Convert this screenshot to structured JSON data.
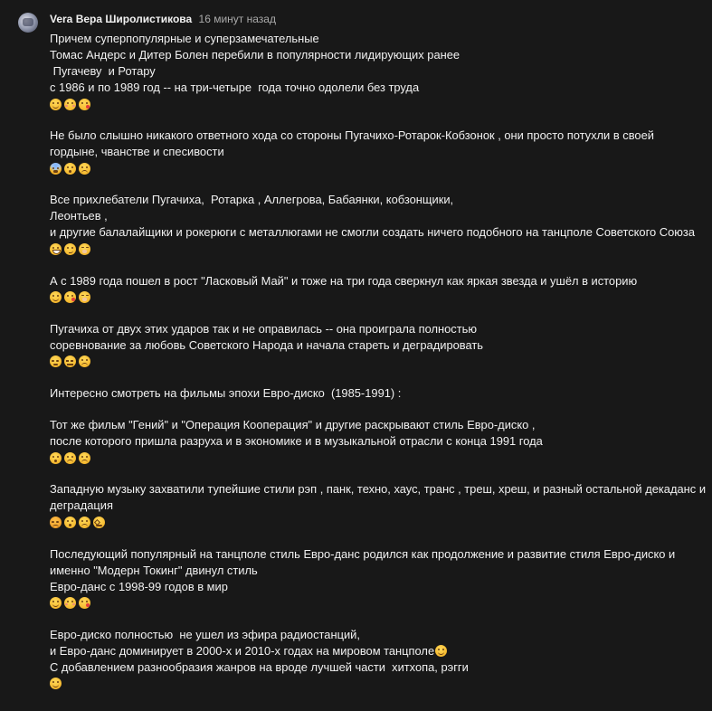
{
  "comment": {
    "author": "Vera Вера Широлистикова",
    "time": "16 минут назад",
    "paragraphs": [
      {
        "lines": [
          "Причем суперпопулярные и суперзамечательные",
          "Томас Андерс и Дитер Болен перебили в популярности лидирующих ранее",
          " Пугачеву  и Ротару",
          "с 1986 и по 1989 год -- на три-четыре  года точно одолели без труда"
        ],
        "emojis": [
          "smile",
          "blush",
          "kiss"
        ]
      },
      {
        "lines": [
          "Не было слышно никакого ответного хода со стороны Пугачихо-Ротарок-Кобзонок , они просто потухли в своей",
          "гордыне, чванстве и спесивости"
        ],
        "emojis": [
          "fear",
          "wow",
          "sad"
        ]
      },
      {
        "lines": [
          "Все прихлебатели Пугачиха,  Ротарка , Аллегрова, Бабаянки, кобзонщики,",
          "Леонтьев ,",
          "и другие балалайщики и рокерюги с металлюгами не смогли создать ничего подобного на танцполе Советского Союза"
        ],
        "emojis": [
          "grin",
          "smirk",
          "giggle"
        ]
      },
      {
        "lines": [
          "А с 1989 года пошел в рост \"Ласковый Май\" и тоже на три года сверкнул как яркая звезда и ушёл в историю"
        ],
        "emojis": [
          "smile",
          "kiss",
          "giggle"
        ]
      },
      {
        "lines": [
          "Пугачиха от двух этих ударов так и не оправилась -- она проиграла полностью",
          "соревнование за любовь Советского Народа и начала стареть и деградировать"
        ],
        "emojis": [
          "unamused",
          "expressionless",
          "sad"
        ]
      },
      {
        "lines": [
          "Интересно смотреть на фильмы эпохи Евро-диско  (1985-1991) :"
        ],
        "emojis": []
      },
      {
        "lines": [
          "Тот же фильм \"Гений\" и \"Операция Кооперация\" и другие раскрывают стиль Евро-диско ,",
          "после которого пришла разруха и в экономике и в музыкальной отрасли с конца 1991 года"
        ],
        "emojis": [
          "wow",
          "sad",
          "sad"
        ]
      },
      {
        "lines": [
          "Западную музыку захватили тупейшие стили рэп , панк, техно, хаус, транс , треш, хреш, и разный остальной декаданс и",
          "деградация"
        ],
        "emojis": [
          "angry",
          "wow",
          "sad",
          "persevere"
        ]
      },
      {
        "lines": [
          "Последующий популярный на танцполе стиль Евро-данс родился как продолжение и развитие стиля Евро-диско и",
          "именно \"Модерн Токинг\" двинул стиль",
          "Евро-данс с 1998-99 годов в мир"
        ],
        "emojis": [
          "smile",
          "blush",
          "kiss"
        ]
      },
      {
        "lines": [
          "Евро-диско полностью  не ушел из эфира радиостанций,",
          "и Евро-данс доминирует в 2000-х и 2010-х годах на мировом танцполе",
          "С добавлением разнообразия жанров на вроде лучшей части  хитхопа, рэгги"
        ],
        "inline_emoji_after_line": 1,
        "inline_emoji": "smile",
        "emojis": [
          "smile"
        ]
      }
    ]
  }
}
